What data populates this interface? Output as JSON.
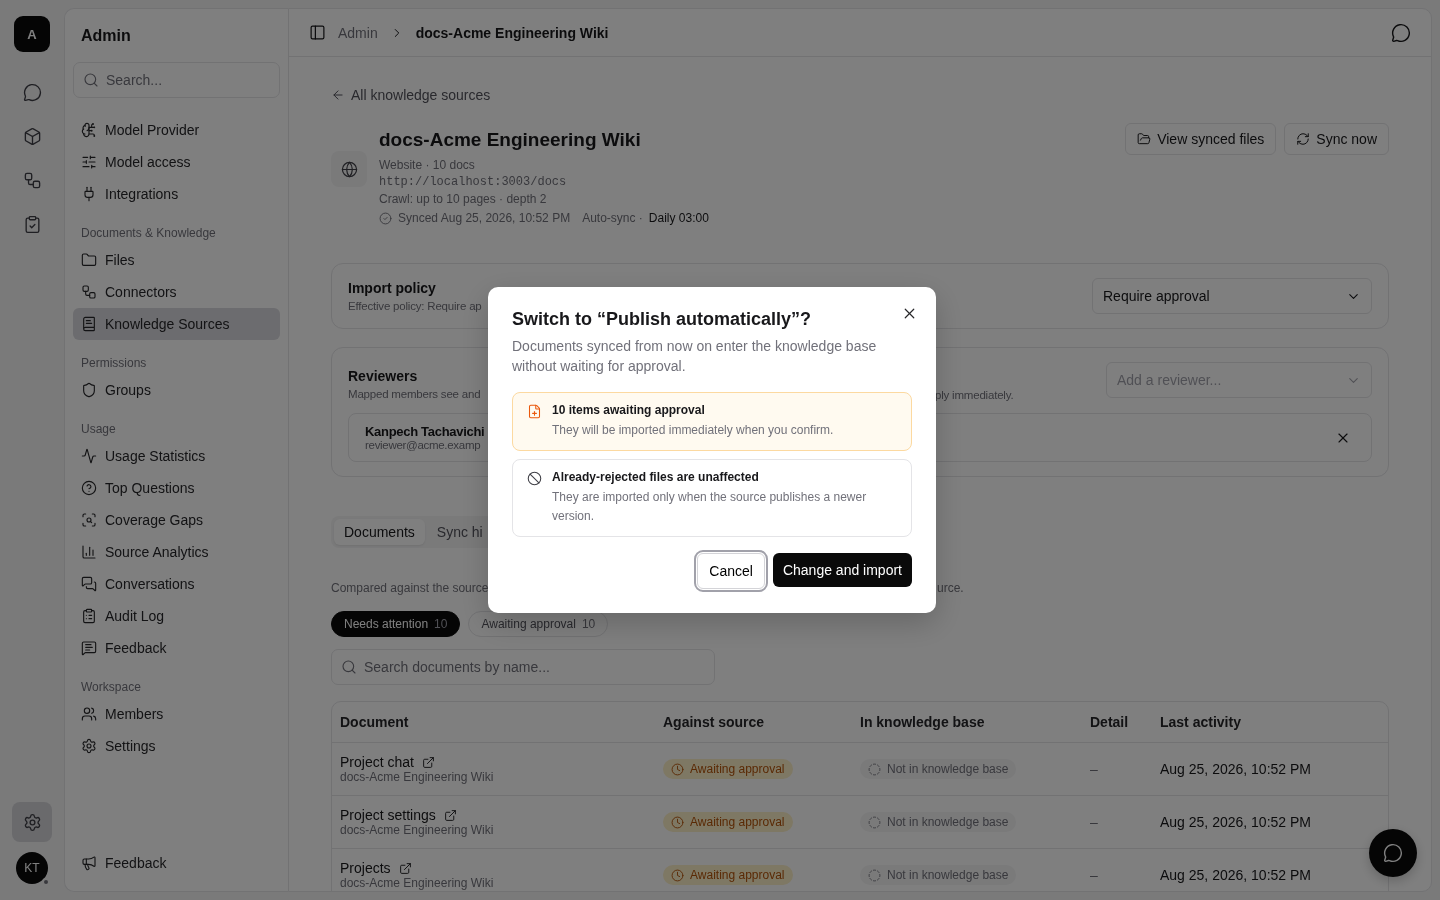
{
  "rail": {
    "logo": "A",
    "settings": {
      "selected": true
    },
    "avatar": "KT"
  },
  "sidebar": {
    "title": "Admin",
    "search": {
      "placeholder": "Search..."
    },
    "sections": [
      {
        "items": [
          {
            "label": "Model Provider",
            "selected": false
          },
          {
            "label": "Model access",
            "selected": false
          },
          {
            "label": "Integrations",
            "selected": false
          }
        ]
      },
      {
        "heading": "Documents & Knowledge",
        "items": [
          {
            "label": "Files",
            "selected": false
          },
          {
            "label": "Connectors",
            "selected": false
          },
          {
            "label": "Knowledge Sources",
            "selected": true
          }
        ]
      },
      {
        "heading": "Permissions",
        "items": [
          {
            "label": "Groups",
            "selected": false
          }
        ]
      },
      {
        "heading": "Usage",
        "items": [
          {
            "label": "Usage Statistics",
            "selected": false
          },
          {
            "label": "Top Questions",
            "selected": false
          },
          {
            "label": "Coverage Gaps",
            "selected": false
          },
          {
            "label": "Source Analytics",
            "selected": false
          },
          {
            "label": "Conversations",
            "selected": false
          },
          {
            "label": "Audit Log",
            "selected": false
          },
          {
            "label": "Feedback",
            "selected": false
          }
        ]
      },
      {
        "heading": "Workspace",
        "items": [
          {
            "label": "Members",
            "selected": false
          },
          {
            "label": "Settings",
            "selected": false
          }
        ]
      }
    ],
    "footer": "Feedback"
  },
  "breadcrumb": [
    "Admin",
    "docs-Acme Engineering Wiki"
  ],
  "back_link": "All knowledge sources",
  "source": {
    "title": "docs-Acme Engineering Wiki",
    "meta": "Website · 10 docs",
    "url": "http://localhost:3003/docs",
    "crawl": "Crawl: up to 10 pages · depth 2",
    "synced": "Synced Aug 25, 2026, 10:52 PM",
    "auto_sync_label": "Auto-sync ·",
    "auto_sync_value": "Daily 03:00",
    "actions": [
      "View synced files",
      "Sync now"
    ]
  },
  "import_policy": {
    "title": "Import policy",
    "description": "Effective policy: Require ap",
    "select": "Require approval"
  },
  "reviewers": {
    "title": "Reviewers",
    "description": "Mapped members see and",
    "description_end": "ply immediately.",
    "add_placeholder": "Add a reviewer...",
    "members": [
      {
        "name": "Kanpech Tachavichi",
        "email": "reviewer@acme.examp"
      }
    ]
  },
  "tabs": [
    {
      "label": "Documents",
      "selected": true
    },
    {
      "label": "Sync hi",
      "selected": false
    }
  ],
  "documents_note": "Compared against the source",
  "documents_note_end": "urce.",
  "filters": [
    {
      "label": "Needs attention",
      "count": "10",
      "selected": true
    },
    {
      "label": "Awaiting approval",
      "count": "10",
      "selected": false
    }
  ],
  "doc_search": {
    "placeholder": "Search documents by name..."
  },
  "table": {
    "columns": [
      "Document",
      "Against source",
      "In knowledge base",
      "Detail",
      "Last activity"
    ],
    "rows": [
      {
        "name": "Project chat",
        "source": "docs-Acme Engineering Wiki",
        "against": {
          "kind": "awaiting",
          "label": "Awaiting approval"
        },
        "kb": {
          "kind": "absent",
          "label": "Not in knowledge base"
        },
        "detail": "–",
        "last": "Aug 25, 2026, 10:52 PM"
      },
      {
        "name": "Project settings",
        "source": "docs-Acme Engineering Wiki",
        "against": {
          "kind": "awaiting",
          "label": "Awaiting approval"
        },
        "kb": {
          "kind": "absent",
          "label": "Not in knowledge base"
        },
        "detail": "–",
        "last": "Aug 25, 2026, 10:52 PM"
      },
      {
        "name": "Projects",
        "source": "docs-Acme Engineering Wiki",
        "against": {
          "kind": "awaiting",
          "label": "Awaiting approval"
        },
        "kb": {
          "kind": "absent",
          "label": "Not in knowledge base"
        },
        "detail": "–",
        "last": "Aug 25, 2026, 10:52 PM"
      }
    ]
  },
  "dialog": {
    "title": "Switch to “Publish automatically”?",
    "description": "Documents synced from now on enter the knowledge base without waiting for approval.",
    "notices": [
      {
        "kind": "warning",
        "title": "10 items awaiting approval",
        "text": "They will be imported immediately when you confirm."
      },
      {
        "kind": "neutral",
        "title": "Already-rejected files are unaffected",
        "text": "They are imported only when the source publishes a newer version."
      }
    ],
    "cancel": "Cancel",
    "confirm": "Change and import"
  }
}
